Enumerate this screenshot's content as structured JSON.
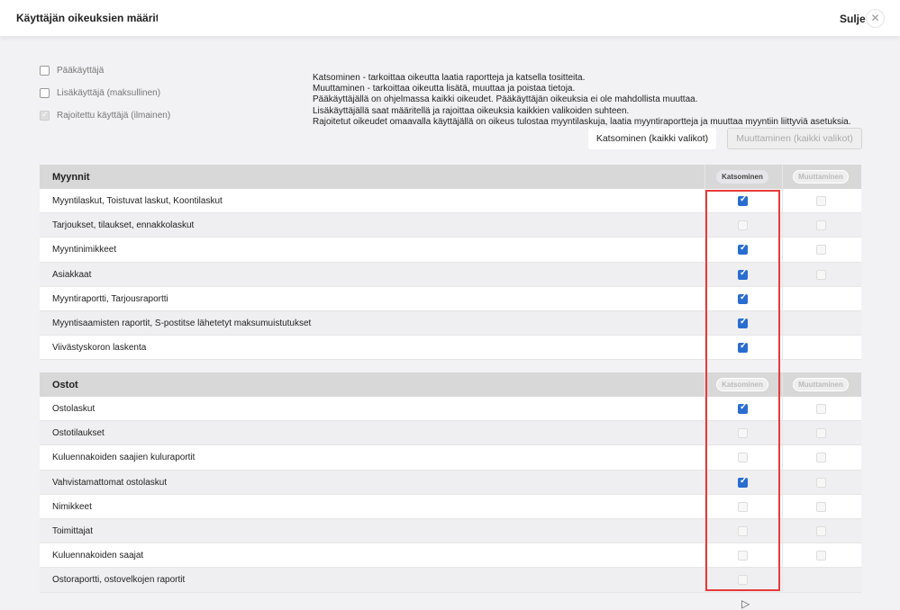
{
  "header": {
    "title": "Käyttäjän oikeuksien määrittely:",
    "close_label": "Sulje",
    "close_icon": "close-icon"
  },
  "roles": [
    {
      "label": "Pääkäyttäjä",
      "checked": false,
      "disabled": false
    },
    {
      "label": "Lisäkäyttäjä (maksullinen)",
      "checked": false,
      "disabled": false
    },
    {
      "label": "Rajoitettu käyttäjä (ilmainen)",
      "checked": true,
      "disabled": true
    }
  ],
  "info": [
    "Katsominen - tarkoittaa oikeutta laatia raportteja ja katsella tositteita.",
    "Muuttaminen - tarkoittaa oikeutta lisätä, muuttaa ja poistaa tietoja.",
    "Pääkäyttäjällä on ohjelmassa kaikki oikeudet. Pääkäyttäjän oikeuksia ei ole mahdollista muuttaa.",
    "Lisäkäyttäjällä saat määritellä ja rajoittaa oikeuksia kaikkien valikoiden suhteen.",
    "Rajoitetut oikeudet omaavalla käyttäjällä on oikeus tulostaa myyntilaskuja, laatia myyntiraportteja ja muuttaa myyntiin liittyviä asetuksia."
  ],
  "buttons": {
    "view_all": "Katsominen (kaikki valikot)",
    "edit_all": "Muuttaminen (kaikki valikot)"
  },
  "columns": {
    "view": "Katsominen",
    "edit": "Muuttaminen"
  },
  "accent": "#2a6dd0",
  "highlight": "#e53a3a",
  "sections": [
    {
      "title": "Myynnit",
      "rows": [
        {
          "label": "Myyntilaskut, Toistuvat laskut, Koontilaskut",
          "view": true,
          "edit": false
        },
        {
          "label": "Tarjoukset, tilaukset, ennakkolaskut",
          "view": false,
          "edit": false
        },
        {
          "label": "Myyntinimikkeet",
          "view": true,
          "edit": false
        },
        {
          "label": "Asiakkaat",
          "view": true,
          "edit": false
        },
        {
          "label": "Myyntiraportti, Tarjousraportti",
          "view": true,
          "edit": null
        },
        {
          "label": "Myyntisaamisten raportit, S-postitse lähetetyt maksumuistutukset",
          "view": true,
          "edit": null
        },
        {
          "label": "Viivästyskoron laskenta",
          "view": true,
          "edit": null
        }
      ]
    },
    {
      "title": "Ostot",
      "rows": [
        {
          "label": "Ostolaskut",
          "view": true,
          "edit": false
        },
        {
          "label": "Ostotilaukset",
          "view": false,
          "edit": false
        },
        {
          "label": "Kuluennakoiden saajien kuluraportit",
          "view": false,
          "edit": false
        },
        {
          "label": "Vahvistamattomat ostolaskut",
          "view": true,
          "edit": false
        },
        {
          "label": "Nimikkeet",
          "view": false,
          "edit": false
        },
        {
          "label": "Toimittajat",
          "view": false,
          "edit": false
        },
        {
          "label": "Kuluennakoiden saajat",
          "view": false,
          "edit": false
        },
        {
          "label": "Ostoraportti, ostovelkojen raportit",
          "view": false,
          "edit": null
        }
      ]
    }
  ]
}
